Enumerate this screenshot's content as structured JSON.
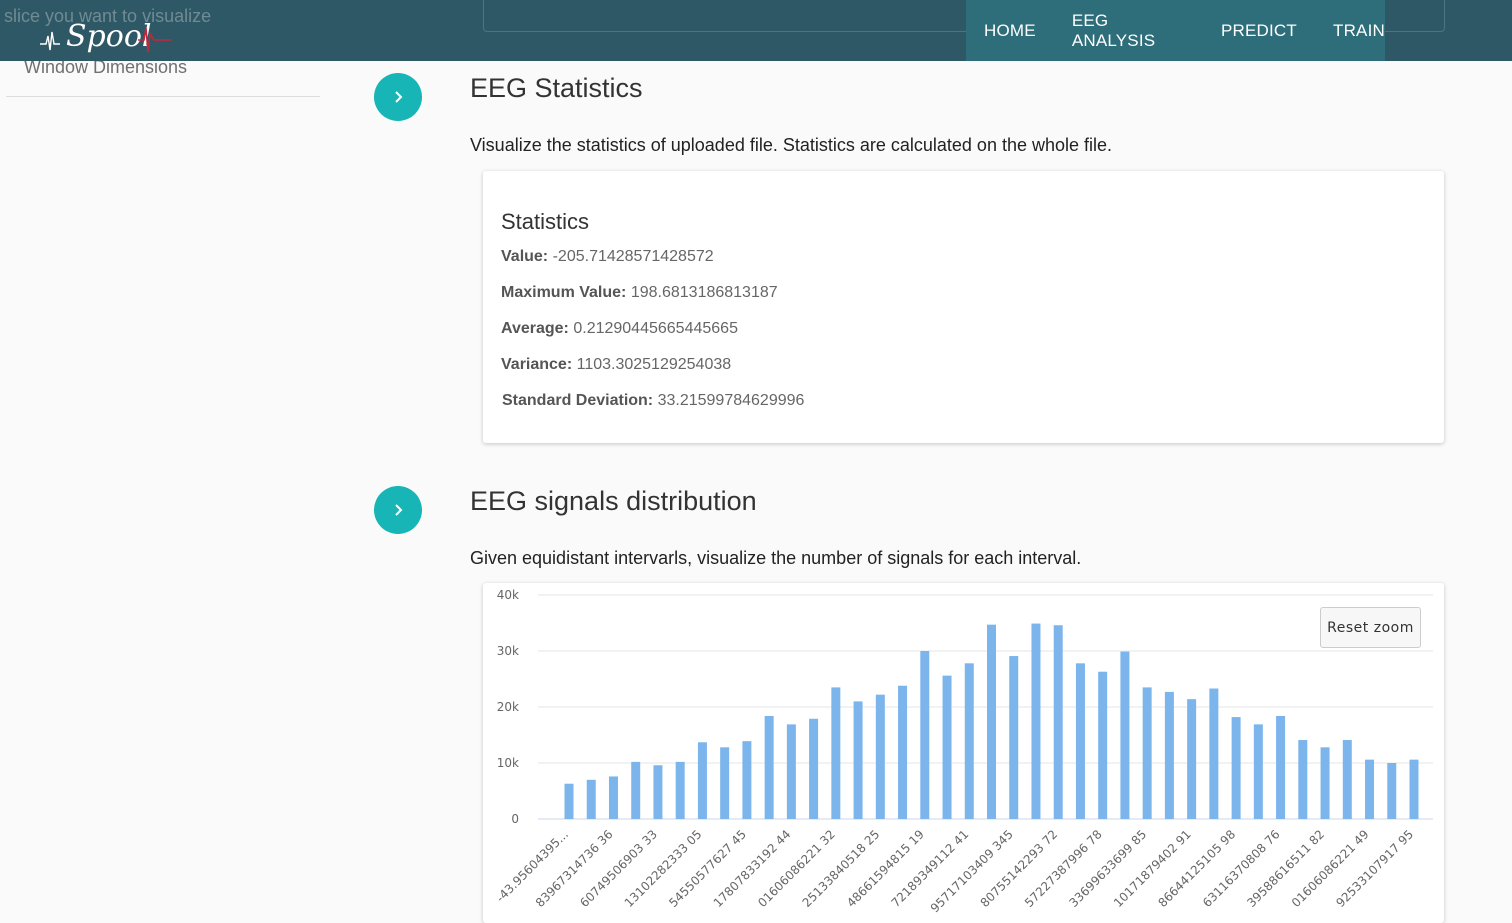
{
  "overlay": {
    "top_text": "slice you want to visualize",
    "sidebar_label": "Window Dimensions"
  },
  "brand": {
    "name": "Spool"
  },
  "nav": {
    "items": [
      {
        "label": "HOME"
      },
      {
        "label": "EEG ANALYSIS"
      },
      {
        "label": "PREDICT"
      },
      {
        "label": "TRAIN"
      }
    ]
  },
  "statistics_section": {
    "title": "EEG Statistics",
    "description": "Visualize the statistics of uploaded file. Statistics are calculated on the whole file.",
    "card_title": "Statistics",
    "rows": [
      {
        "label": "Value:",
        "value": "-205.71428571428572"
      },
      {
        "label": "Maximum Value:",
        "value": "198.6813186813187"
      },
      {
        "label": "Average:",
        "value": "0.21290445665445665"
      },
      {
        "label": "Variance:",
        "value": "1103.3025129254038"
      },
      {
        "label": "Standard Deviation:",
        "value": "33.21599784629996"
      }
    ]
  },
  "distribution_section": {
    "title": "EEG signals distribution",
    "description": "Given equidistant intervarls, visualize the number of signals for each interval.",
    "reset_zoom_label": "Reset zoom"
  },
  "colors": {
    "bar": "#7cb5ec",
    "step_button": "#17b5b5",
    "navbar": "#2f5866",
    "nav_menu": "#2e6d7a"
  },
  "chart_data": {
    "type": "bar",
    "ylim": [
      0,
      40000
    ],
    "y_ticks": [
      "0",
      "10k",
      "20k",
      "30k",
      "40k"
    ],
    "grid": true,
    "categories": [
      "-43.95604395...",
      "",
      "-",
      "",
      "-",
      "",
      "-",
      "",
      "-",
      "",
      "-",
      "",
      "-",
      "",
      "-",
      "",
      "-",
      "",
      "-",
      "",
      "-",
      "",
      "-",
      "",
      "-",
      "",
      "-",
      "",
      "-",
      "",
      "-",
      "",
      "-",
      "",
      "-",
      "",
      "-",
      "",
      "-",
      "",
      "-"
    ],
    "x_tick_labels": [
      "-43.95604395...",
      "83967314736 36",
      "60749506903 33",
      "13102282333 05",
      "54550577627 45",
      "17807833192 44",
      "01606086221 32",
      "25133840518 25",
      "48661594815 19",
      "72189349112 41",
      "95717103409 345",
      "80755142293 72",
      "57227387996 78",
      "33699633699 85",
      "10171879402 91",
      "86644125105 98",
      "63116370808 76",
      "39588616511 82",
      "01606086221 49",
      "92533107917 95"
    ],
    "values": [
      6300,
      7000,
      7600,
      10200,
      9600,
      10200,
      13700,
      12800,
      13900,
      18400,
      16900,
      17900,
      23500,
      21000,
      22200,
      23800,
      30000,
      25600,
      27800,
      34700,
      29100,
      34900,
      34600,
      27800,
      26300,
      29900,
      23500,
      22700,
      21400,
      23300,
      18200,
      16900,
      18400,
      14100,
      12800,
      14100,
      10600,
      10000,
      10600
    ]
  }
}
